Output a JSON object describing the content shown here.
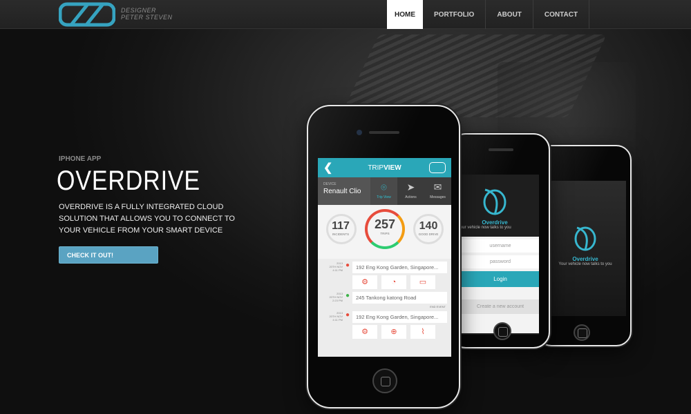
{
  "header": {
    "logo_line1": "DESIGNER",
    "logo_line2": "PETER STEVEN",
    "nav": [
      "HOME",
      "PORTFOLIO",
      "ABOUT",
      "CONTACT"
    ]
  },
  "hero": {
    "eyebrow": "IPHONE APP",
    "title": "OVERDRIVE",
    "description": "OVERDRIVE IS A FULLY INTEGRATED CLOUD SOLUTION THAT ALLOWS YOU TO CONNECT TO YOUR VEHICLE FROM YOUR SMART DEVICE",
    "cta_label": "CHECK IT OUT!"
  },
  "app": {
    "header_title_a": "TRIP ",
    "header_title_b": "VIEW",
    "device_label": "DEVICE",
    "device_value": "Renault Clio",
    "tabs": [
      "Trip View",
      "Actions",
      "Messages"
    ],
    "stats": {
      "incidents": "117",
      "incidents_label": "INCIDENTS",
      "trips": "257",
      "trips_label": "TRIPS",
      "good_drive": "140",
      "good_drive_label": "GOOD DRIVE"
    },
    "entries": [
      {
        "date1": "2013",
        "date2": "20TH NOV",
        "date3": "4:11 PM",
        "address": "192 Eng Kong Garden, Singapore..."
      },
      {
        "date1": "2013",
        "date2": "20TH NOV",
        "date3": "2:23 PM",
        "address": "245 Tankong katong Road"
      },
      {
        "date1": "2013",
        "date2": "20TH NOV",
        "date3": "4:11 PM",
        "address": "192 Eng Kong Garden, Singapore..."
      }
    ],
    "end_event": "END EVENT"
  },
  "login": {
    "brand": "Overdrive",
    "tagline": "Your vehicle now talks to you",
    "tagline_partial": "our vehicle now talks to you",
    "username": "username",
    "password": "password",
    "login_button": "Login",
    "create": "Create a new account"
  },
  "colors": {
    "accent": "#2aa7b8",
    "cta": "#5aa3c2",
    "alert": "#e74c3c"
  }
}
